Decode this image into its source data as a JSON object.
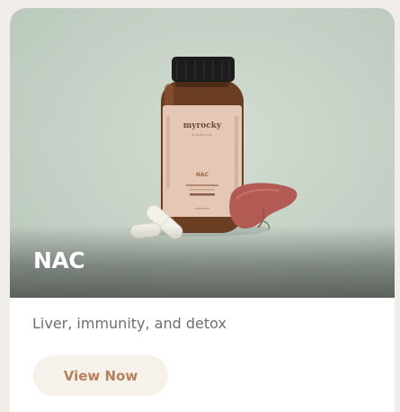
{
  "card": {
    "title": "NAC",
    "description": "Liver, immunity, and detox",
    "button_label": "View Now"
  },
  "product_image": {
    "brand": "myrocky",
    "sub": "organics",
    "label_name": "NAC"
  },
  "colors": {
    "hero_background": "#c5d1c6",
    "button_background": "#f6f1eb",
    "button_text": "#b5825d",
    "description_text": "#6e6e6e",
    "page_background": "#f1eeea"
  }
}
